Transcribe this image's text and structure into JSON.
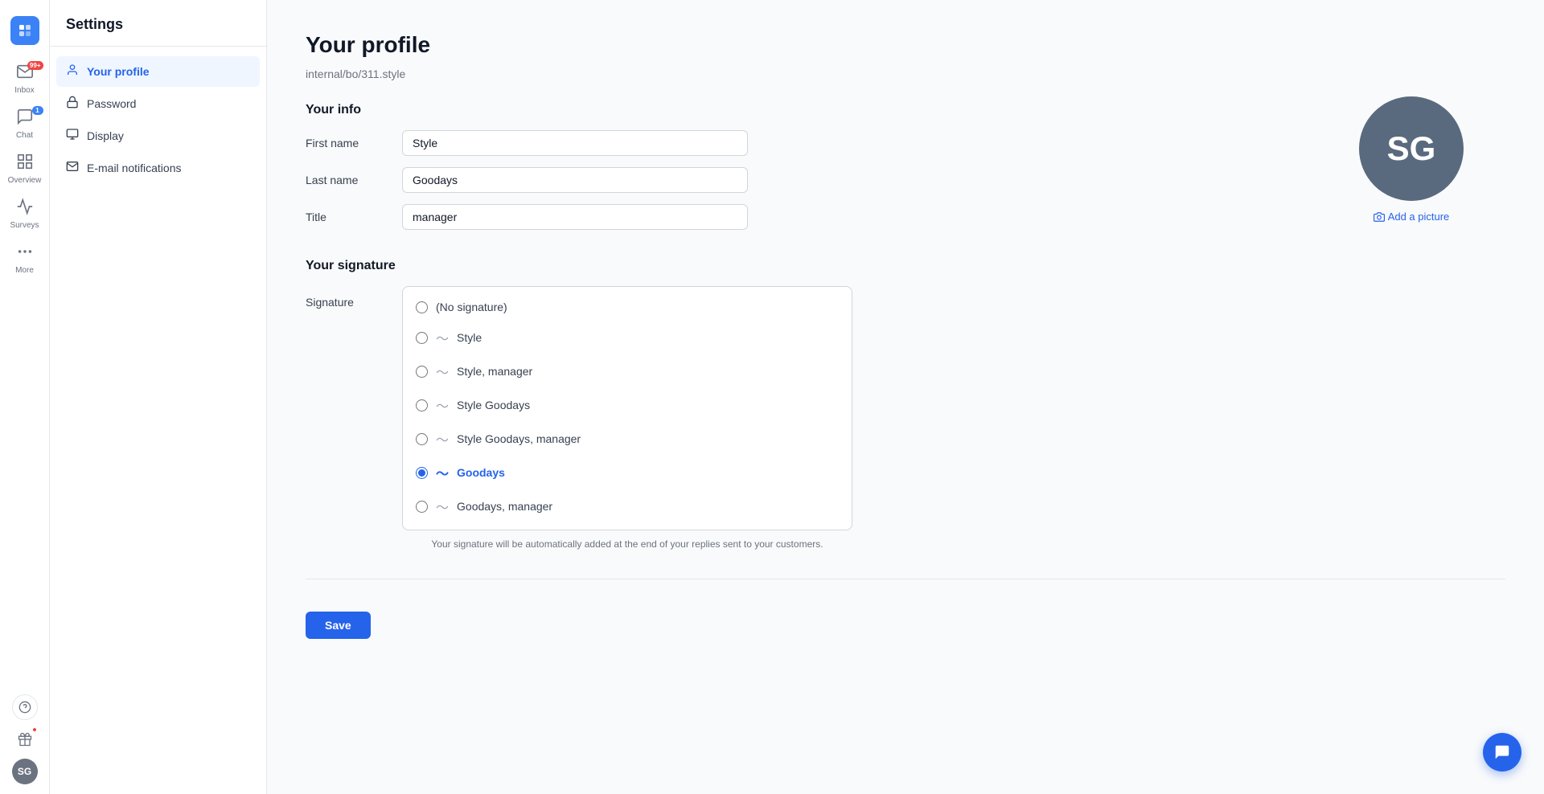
{
  "app": {
    "logo_letter": "✦",
    "accent_color": "#3b82f6"
  },
  "icon_nav": {
    "items": [
      {
        "id": "inbox",
        "label": "Inbox",
        "icon": "📥",
        "badge": "99+",
        "badge_color": "red"
      },
      {
        "id": "chat",
        "label": "Chat",
        "icon": "💬",
        "badge": "1",
        "badge_color": "blue"
      },
      {
        "id": "overview",
        "label": "Overview",
        "icon": "⊞",
        "badge": null
      },
      {
        "id": "surveys",
        "label": "Surveys",
        "icon": "🎁",
        "badge": null
      },
      {
        "id": "more",
        "label": "More",
        "icon": "⊕",
        "badge": null
      }
    ],
    "bottom_items": [
      {
        "id": "help",
        "icon": "?",
        "label": "Help"
      },
      {
        "id": "gift",
        "icon": "🎁",
        "label": "Gift",
        "badge": true
      },
      {
        "id": "avatar",
        "initials": "SG",
        "label": "Profile"
      }
    ]
  },
  "sidebar": {
    "title": "Settings",
    "items": [
      {
        "id": "your-profile",
        "label": "Your profile",
        "icon": "👤",
        "active": true
      },
      {
        "id": "password",
        "label": "Password",
        "icon": "🔑",
        "active": false
      },
      {
        "id": "display",
        "label": "Display",
        "icon": "🖥",
        "active": false
      },
      {
        "id": "email-notifications",
        "label": "E-mail notifications",
        "icon": "✉",
        "active": false
      }
    ]
  },
  "page": {
    "title": "Your profile",
    "breadcrumb": "internal/bo/311.style",
    "sections": {
      "your_info": {
        "title": "Your info",
        "fields": {
          "first_name": {
            "label": "First name",
            "value": "Style"
          },
          "last_name": {
            "label": "Last name",
            "value": "Goodays"
          },
          "title_field": {
            "label": "Title",
            "value": "manager"
          }
        }
      },
      "your_signature": {
        "title": "Your signature",
        "label": "Signature",
        "options": [
          {
            "id": "no-sig",
            "label": "(No signature)",
            "has_wave": false,
            "selected": false
          },
          {
            "id": "style",
            "label": "Style",
            "has_wave": true,
            "selected": false
          },
          {
            "id": "style-manager",
            "label": "Style, manager",
            "has_wave": true,
            "selected": false
          },
          {
            "id": "style-goodays",
            "label": "Style Goodays",
            "has_wave": true,
            "selected": false
          },
          {
            "id": "style-goodays-manager",
            "label": "Style Goodays, manager",
            "has_wave": true,
            "selected": false
          },
          {
            "id": "goodays",
            "label": "Goodays",
            "has_wave": true,
            "selected": true
          },
          {
            "id": "goodays-manager",
            "label": "Goodays, manager",
            "has_wave": true,
            "selected": false
          }
        ],
        "note": "Your signature will be automatically added at the end of your replies sent to your customers."
      }
    },
    "avatar": {
      "initials": "SG",
      "add_picture_label": "Add a picture"
    },
    "save_button": "Save"
  },
  "chat_fab": {
    "icon": "💬"
  }
}
